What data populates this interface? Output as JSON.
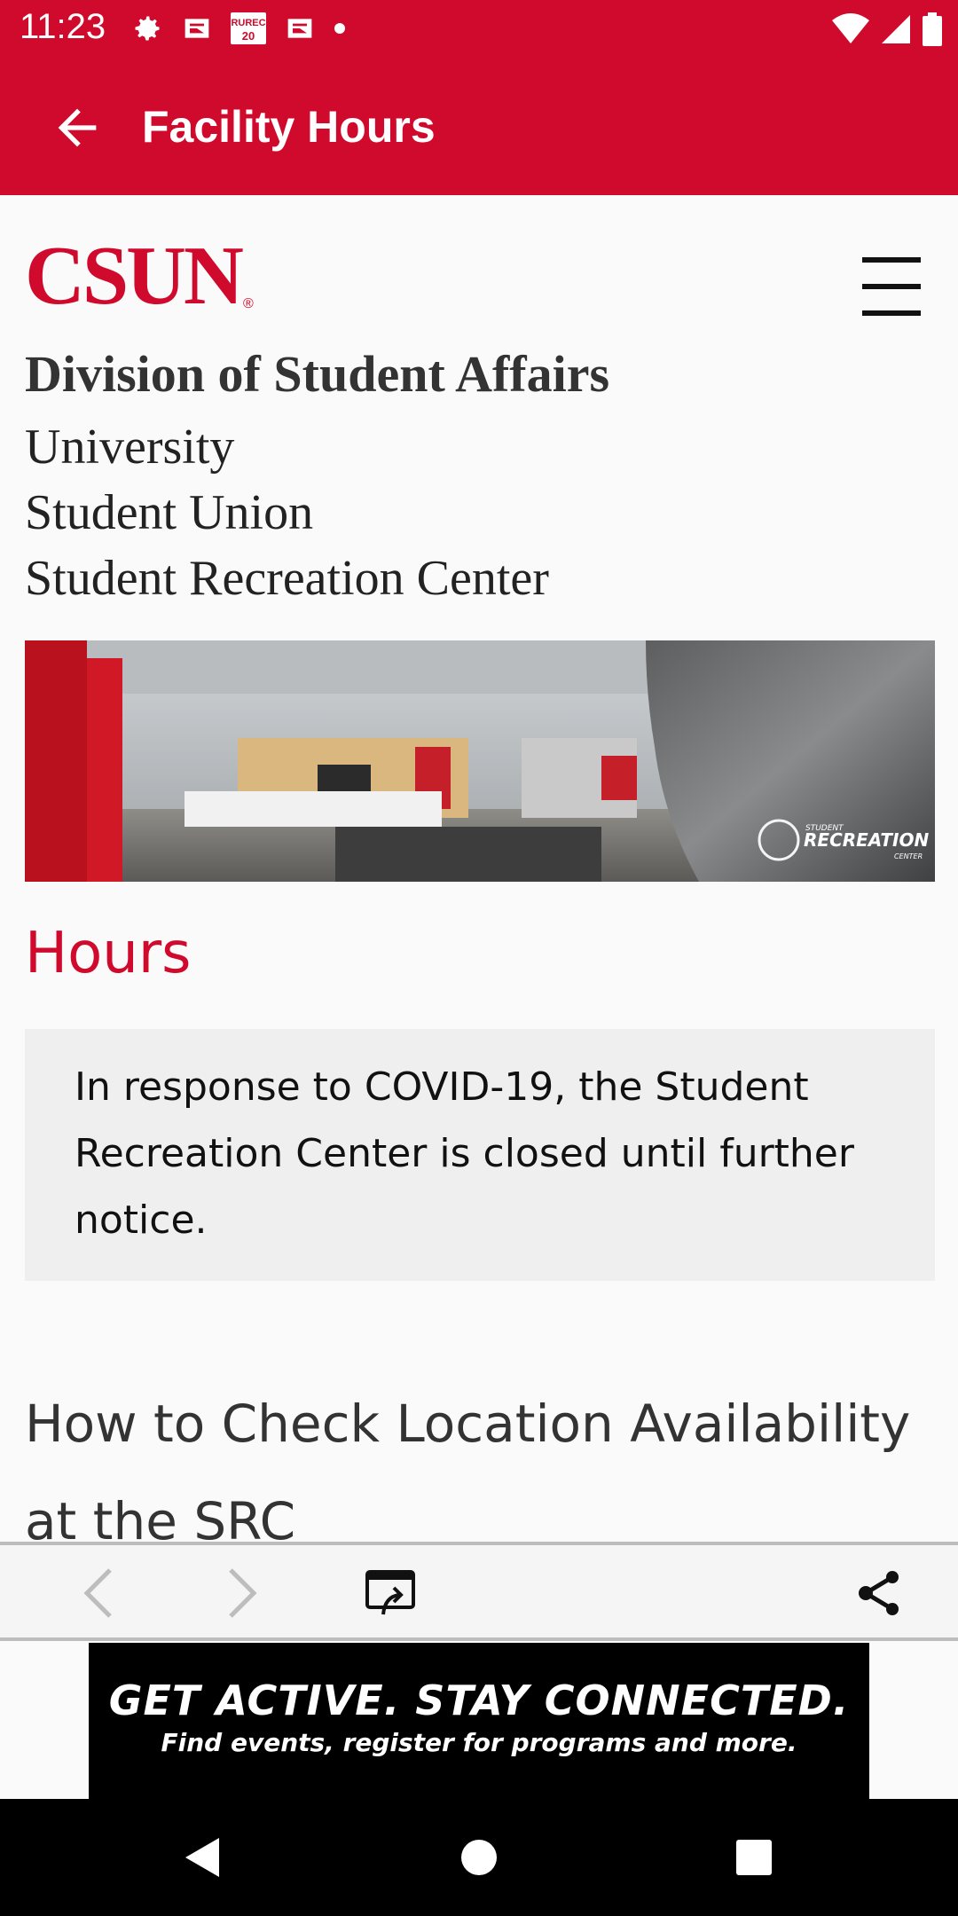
{
  "status_bar": {
    "time": "11:23",
    "left_icons": [
      "settings-icon",
      "news-icon",
      "rurec-icon",
      "news-icon",
      "dot-icon"
    ],
    "right_icons": [
      "wifi-icon",
      "signal-icon",
      "battery-icon"
    ],
    "small_icon_text": "RUREC"
  },
  "app_bar": {
    "title": "Facility Hours",
    "color": "#cf0a2c"
  },
  "web": {
    "logo_text": "CSUN",
    "logo_mark": "®",
    "division_title": "Division of Student Affairs",
    "breadcrumb_lines": [
      "University",
      "Student Union",
      "Student Recreation Center"
    ],
    "hero_watermark_small": "STUDENT",
    "hero_watermark": "RECREATION",
    "hero_watermark_sub": "CENTER",
    "hours_heading": "Hours",
    "notice": "In response to COVID-19, the Student Recreation Center is closed until further notice.",
    "section_heading": "How to Check Location Availability at the SRC"
  },
  "toolbar": {
    "icons": [
      "back-arrow-icon",
      "forward-arrow-icon",
      "open-in-browser-icon",
      "share-icon"
    ]
  },
  "ad": {
    "headline": "GET ACTIVE.  STAY CONNECTED.",
    "subline": "Find events, register for programs and more."
  },
  "nav_bar": {
    "icons": [
      "back-triangle-icon",
      "home-circle-icon",
      "recents-square-icon"
    ]
  }
}
